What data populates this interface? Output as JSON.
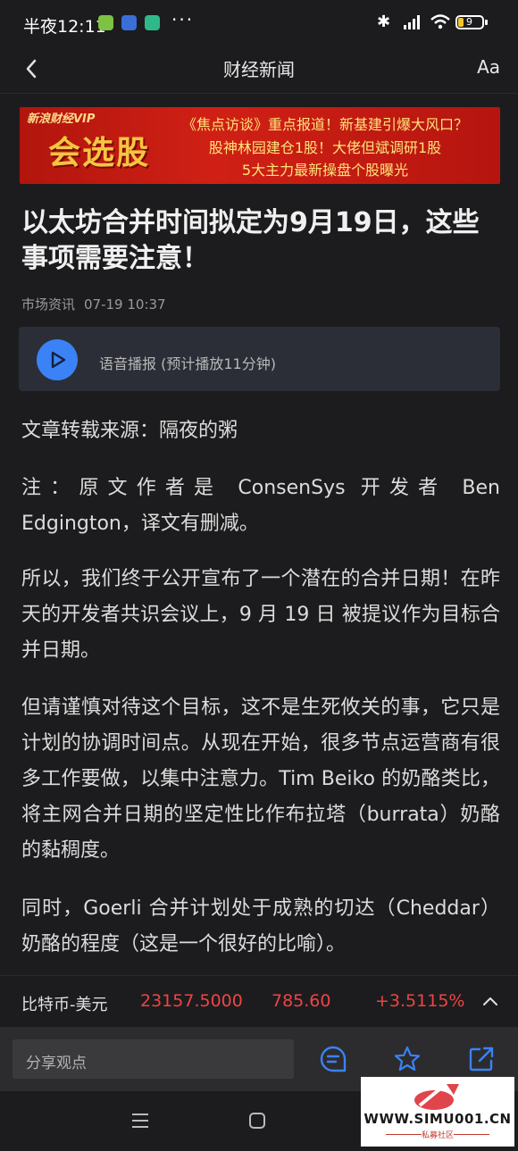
{
  "status_bar": {
    "time": "半夜12:11",
    "battery": "9"
  },
  "header": {
    "title": "财经新闻",
    "font_button": "Aa"
  },
  "banner": {
    "brand": "新浪财经VIP",
    "headline": "会选股",
    "line1": "《焦点访谈》重点报道！新基建引爆大风口？",
    "line2": "股神林园建仓1股！大佬但斌调研1股",
    "line3": "5大主力最新操盘个股曝光"
  },
  "article": {
    "title": "以太坊合并时间拟定为9月19日，这些事项需要注意！",
    "source": "市场资讯",
    "datetime": "07-19 10:37",
    "audio_label": "语音播报 (预计播放11分钟)",
    "paragraphs": [
      "文章转载来源：隔夜的粥",
      "注：原文作者是 ConsenSys 开发者 Ben Edgington，译文有删减。",
      "所以，我们终于公开宣布了一个潜在的合并日期！在昨天的开发者共识会议上，9 月 19 日 被提议作为目标合并日期。",
      "但请谨慎对待这个目标，这不是生死攸关的事，它只是计划的协调时间点。从现在开始，很多节点运营商有很多工作要做，以集中注意力。Tim Beiko 的奶酪类比，将主网合并日期的坚定性比作布拉塔（burrata）奶酪的黏稠度。",
      "同时，Goerli 合并计划处于成熟的切达（Cheddar）奶酪的程度（这是一个很好的比喻）。"
    ]
  },
  "ticker": {
    "name": "比特币-美元",
    "price": "23157.5000",
    "change": "785.60",
    "change_pct": "+3.5115%",
    "color": "#ef4444"
  },
  "action_bar": {
    "share_placeholder": "分享观点"
  },
  "watermark": {
    "url": "WWW.SIMU001.CN",
    "sub": "私募社区"
  }
}
